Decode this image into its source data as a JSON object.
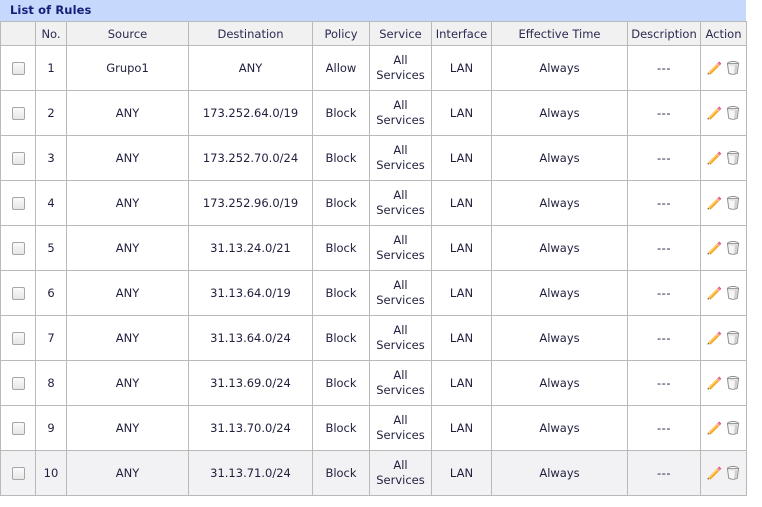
{
  "panel": {
    "title": "List of Rules",
    "title_bg": "#c6d8fb",
    "title_color": "#13217a"
  },
  "table": {
    "columns": [
      {
        "key": "check",
        "label": ""
      },
      {
        "key": "no",
        "label": "No."
      },
      {
        "key": "source",
        "label": "Source"
      },
      {
        "key": "destination",
        "label": "Destination"
      },
      {
        "key": "policy",
        "label": "Policy"
      },
      {
        "key": "service",
        "label": "Service"
      },
      {
        "key": "interface",
        "label": "Interface"
      },
      {
        "key": "effective",
        "label": "Effective Time"
      },
      {
        "key": "description",
        "label": "Description"
      },
      {
        "key": "action",
        "label": "Action"
      }
    ],
    "rows": [
      {
        "no": "1",
        "source": "Grupo1",
        "destination": "ANY",
        "policy": "Allow",
        "service_line1": "All",
        "service_line2": "Services",
        "interface": "LAN",
        "effective": "Always",
        "description": "---",
        "checked": false,
        "highlighted": false
      },
      {
        "no": "2",
        "source": "ANY",
        "destination": "173.252.64.0/19",
        "policy": "Block",
        "service_line1": "All",
        "service_line2": "Services",
        "interface": "LAN",
        "effective": "Always",
        "description": "---",
        "checked": false,
        "highlighted": false
      },
      {
        "no": "3",
        "source": "ANY",
        "destination": "173.252.70.0/24",
        "policy": "Block",
        "service_line1": "All",
        "service_line2": "Services",
        "interface": "LAN",
        "effective": "Always",
        "description": "---",
        "checked": false,
        "highlighted": false
      },
      {
        "no": "4",
        "source": "ANY",
        "destination": "173.252.96.0/19",
        "policy": "Block",
        "service_line1": "All",
        "service_line2": "Services",
        "interface": "LAN",
        "effective": "Always",
        "description": "---",
        "checked": false,
        "highlighted": false
      },
      {
        "no": "5",
        "source": "ANY",
        "destination": "31.13.24.0/21",
        "policy": "Block",
        "service_line1": "All",
        "service_line2": "Services",
        "interface": "LAN",
        "effective": "Always",
        "description": "---",
        "checked": false,
        "highlighted": false
      },
      {
        "no": "6",
        "source": "ANY",
        "destination": "31.13.64.0/19",
        "policy": "Block",
        "service_line1": "All",
        "service_line2": "Services",
        "interface": "LAN",
        "effective": "Always",
        "description": "---",
        "checked": false,
        "highlighted": false
      },
      {
        "no": "7",
        "source": "ANY",
        "destination": "31.13.64.0/24",
        "policy": "Block",
        "service_line1": "All",
        "service_line2": "Services",
        "interface": "LAN",
        "effective": "Always",
        "description": "---",
        "checked": false,
        "highlighted": false
      },
      {
        "no": "8",
        "source": "ANY",
        "destination": "31.13.69.0/24",
        "policy": "Block",
        "service_line1": "All",
        "service_line2": "Services",
        "interface": "LAN",
        "effective": "Always",
        "description": "---",
        "checked": false,
        "highlighted": false
      },
      {
        "no": "9",
        "source": "ANY",
        "destination": "31.13.70.0/24",
        "policy": "Block",
        "service_line1": "All",
        "service_line2": "Services",
        "interface": "LAN",
        "effective": "Always",
        "description": "---",
        "checked": false,
        "highlighted": false
      },
      {
        "no": "10",
        "source": "ANY",
        "destination": "31.13.71.0/24",
        "policy": "Block",
        "service_line1": "All",
        "service_line2": "Services",
        "interface": "LAN",
        "effective": "Always",
        "description": "---",
        "checked": false,
        "highlighted": true
      }
    ],
    "row_icons": {
      "edit": "pencil-icon",
      "delete": "trash-icon"
    }
  }
}
